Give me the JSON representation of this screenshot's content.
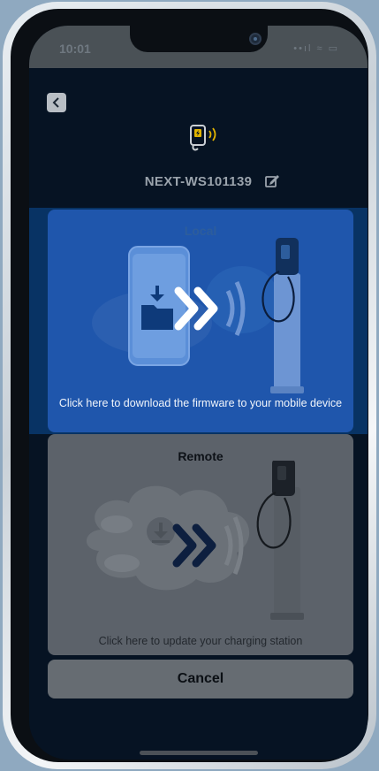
{
  "status_bar": {
    "time": "10:01",
    "indicators": "••ıl ≈ ▭"
  },
  "header": {
    "back_icon": "chevron-left-icon",
    "device_icon": "ev-charger-icon",
    "device_name": "NEXT-WS101139",
    "edit_icon": "edit-icon"
  },
  "options": {
    "local": {
      "title": "Local",
      "description": "Click here to download the firmware to your mobile device",
      "bg_color": "#1f56ac"
    },
    "remote": {
      "title": "Remote",
      "description": "Click here to update your charging station",
      "bg_color": "#5c626a"
    }
  },
  "cancel_label": "Cancel",
  "colors": {
    "screen_bg": "#061323",
    "highlight_band": "#083364",
    "accent": "#1f56ac"
  }
}
